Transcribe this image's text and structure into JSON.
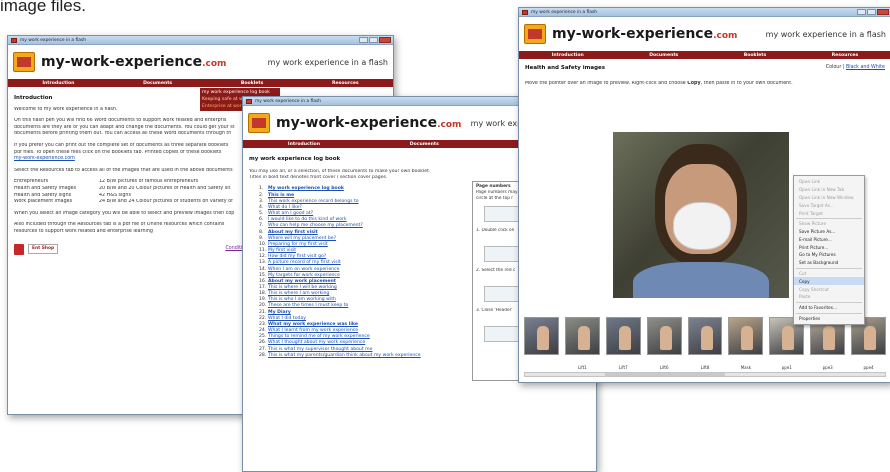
{
  "caption": "image files.",
  "window_title": "my work experience in a flash",
  "brand": {
    "name": "my-work-experience",
    "com": ".com",
    "tagline": "my work experience in a flash"
  },
  "nav": [
    "Introduction",
    "Documents",
    "Booklets",
    "Resources"
  ],
  "w1": {
    "heading": "Introduction",
    "welcome": "Welcome to my work experience in a flash.",
    "para1a": "On this flash pen you will find 66 Word documents to support work related and enterpris",
    "para1b": "documents are they are or you can adapt and change the documents. You could get your st",
    "para1c": "documents before printing them out. You can access all these Word documents through th",
    "para2a": "If you prefer you can print out the complete set of documents as three separate booklets",
    "para2b": "pdf files. To open these files click on the Booklets tab. Printed copies of these booklets",
    "para2link": "my-work-experience.com",
    "para3": "Select the Resources tab to access all of the images that are used in the above documents",
    "table": [
      [
        "Entrepreneurs",
        "12 B/W pictures of famous entrepreneurs"
      ],
      [
        "Health and Safety images",
        "20 B/W and 20 Colour pictures of Health and Safety sit"
      ],
      [
        "Health and Safety signs",
        "42 H&S signs"
      ],
      [
        "Work placement images",
        "24 B/W and 24 Colour pictures of students on variety of"
      ]
    ],
    "para4": "When you select an image category you will be able to select and preview images then cop",
    "para5a": "Also included through the Resources tab is a pdf file of Online resources which contains",
    "para5b": "resources to support work related and enterprise learning",
    "conditions": "Conditions of use",
    "badge": "Ent Shop",
    "dropdown": [
      "my work experience log book",
      "Keeping safe at work",
      "Enterprise at work"
    ]
  },
  "w2": {
    "heading": "my work experience log book",
    "intro1": "You may use all, or a selection, of these documents to make your own booklet.",
    "intro2": "Titles in bold text denotes front cover / section cover pages.",
    "items": [
      {
        "n": "1.",
        "t": "My work experience log book",
        "b": true
      },
      {
        "n": "2.",
        "t": "This is me",
        "b": true
      },
      {
        "n": "3.",
        "t": "This work experience record belongs to",
        "b": false
      },
      {
        "n": "4.",
        "t": "What do I like?",
        "b": false
      },
      {
        "n": "5.",
        "t": "What am I good at?",
        "b": false
      },
      {
        "n": "6.",
        "t": "I would like to do this kind of work",
        "b": false
      },
      {
        "n": "7.",
        "t": "Who can help me choose my placement?",
        "b": false
      },
      {
        "n": "8.",
        "t": "About my first visit",
        "b": true
      },
      {
        "n": "9.",
        "t": "Where will my placement be?",
        "b": false
      },
      {
        "n": "10.",
        "t": "Preparing for my first visit",
        "b": false
      },
      {
        "n": "11.",
        "t": "My first visit",
        "b": false
      },
      {
        "n": "12.",
        "t": "How did my first visit go?",
        "b": false
      },
      {
        "n": "13.",
        "t": "A picture record of my first visit",
        "b": false
      },
      {
        "n": "14.",
        "t": "When I am on work experience",
        "b": false
      },
      {
        "n": "15.",
        "t": "My targets for work experience",
        "b": false
      },
      {
        "n": "16.",
        "t": "About my work placement",
        "b": true
      },
      {
        "n": "17.",
        "t": "This is where I will be working",
        "b": false
      },
      {
        "n": "18.",
        "t": "This is where I am working",
        "b": false
      },
      {
        "n": "19.",
        "t": "This is who I am working with",
        "b": false
      },
      {
        "n": "20.",
        "t": "These are the times I must keep to",
        "b": false
      },
      {
        "n": "21.",
        "t": "My Diary",
        "b": true
      },
      {
        "n": "22.",
        "t": "What I did today",
        "b": false
      },
      {
        "n": "23.",
        "t": "What my work experience was like",
        "b": true
      },
      {
        "n": "24.",
        "t": "What I learnt from my work experience",
        "b": false
      },
      {
        "n": "25.",
        "t": "Things to remind me of my work experience",
        "b": false
      },
      {
        "n": "26.",
        "t": "What I thought about my work experience",
        "b": false
      },
      {
        "n": "27.",
        "t": "This is what my supervisor thought about me",
        "b": false
      },
      {
        "n": "28.",
        "t": "This is what my parents/guardian think about my work experience",
        "b": false
      }
    ],
    "side_title": "Page numbers",
    "side1": "Page numbers may",
    "side2": "circle at the top r",
    "step1": "1. Double click on",
    "step2": "2. Select the red c",
    "step3": "3. Close 'Header'"
  },
  "w3": {
    "heading": "Health and Safety images",
    "colour": "Colour",
    "bw": "Black and White",
    "instruction_a": "Move the pointer over an image to preview. Right-click and choose ",
    "instruction_copy": "Copy",
    "instruction_b": ", then paste in to your own document.",
    "menu": [
      {
        "t": "Open Link",
        "dis": true
      },
      {
        "t": "Open Link in New Tab",
        "dis": true
      },
      {
        "t": "Open Link in New Window",
        "dis": true
      },
      {
        "t": "Save Target As...",
        "dis": true
      },
      {
        "t": "Print Target",
        "dis": true
      },
      {
        "t": "-"
      },
      {
        "t": "Show Picture",
        "dis": true
      },
      {
        "t": "Save Picture As...",
        "dis": false
      },
      {
        "t": "E-mail Picture...",
        "dis": false
      },
      {
        "t": "Print Picture...",
        "dis": false
      },
      {
        "t": "Go to My Pictures",
        "dis": false
      },
      {
        "t": "Set as Background",
        "dis": false
      },
      {
        "t": "-"
      },
      {
        "t": "Cut",
        "dis": true
      },
      {
        "t": "Copy",
        "dis": false,
        "sel": true
      },
      {
        "t": "Copy Shortcut",
        "dis": true
      },
      {
        "t": "Paste",
        "dis": true
      },
      {
        "t": "-"
      },
      {
        "t": "Add to Favorites...",
        "dis": false
      },
      {
        "t": "-"
      },
      {
        "t": "Properties",
        "dis": false
      }
    ],
    "thumb_labels": [
      "",
      "Lift1",
      "Lift7",
      "Lift6",
      "Lift8",
      "Mask",
      "ppe1",
      "ppe3",
      "ppe4"
    ]
  },
  "colors": {
    "nav": "#8d1a1a",
    "link": "#1a4fb5",
    "accent": "#c0392b"
  }
}
